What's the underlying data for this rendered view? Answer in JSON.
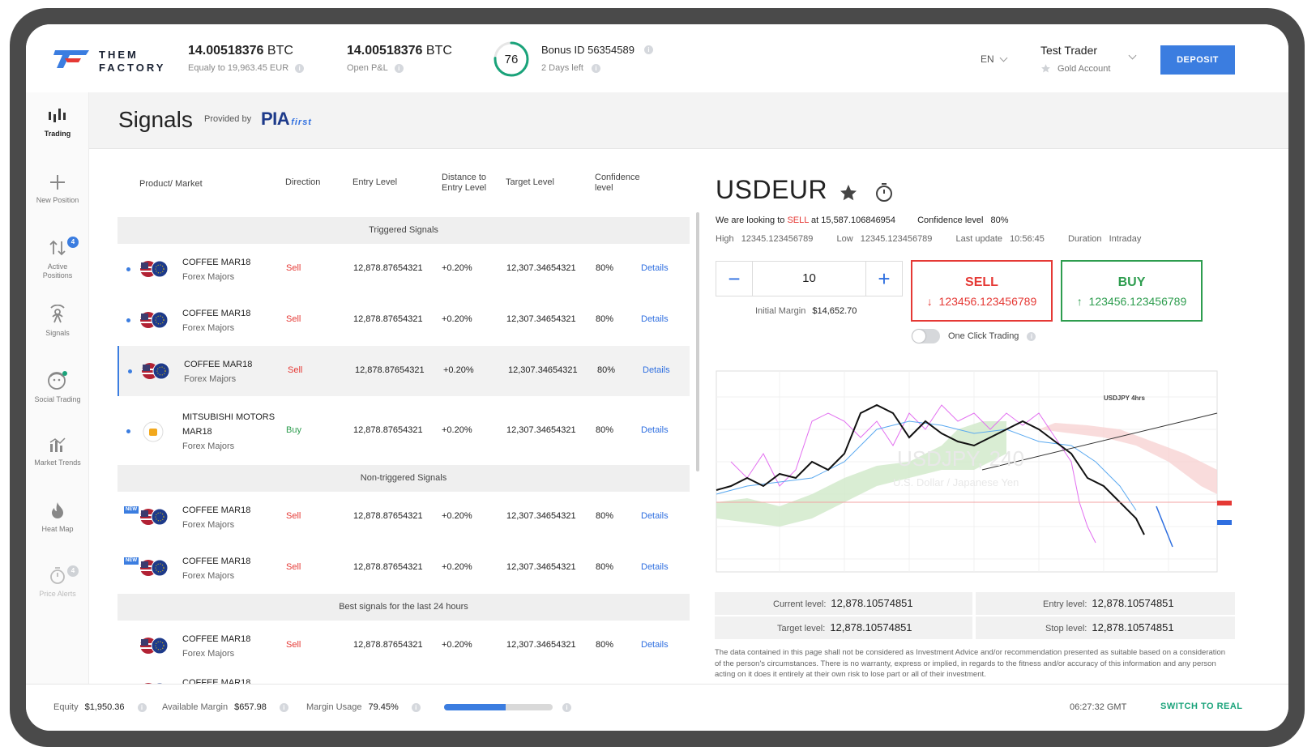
{
  "app": {
    "logo_line1": "THEM",
    "logo_line2": "FACTORY"
  },
  "header": {
    "balance_value": "14.00518376",
    "balance_unit": "BTC",
    "balance_sub": "Equaly to 19,963.45 EUR",
    "pnl_value": "14.00518376",
    "pnl_unit": "BTC",
    "pnl_sub": "Open P&L",
    "bonus_score": "76",
    "bonus_score_fraction": 0.76,
    "bonus_title": "Bonus ID 56354589",
    "bonus_sub": "2 Days left",
    "language": "EN",
    "user_name": "Test Trader",
    "account_type": "Gold Account",
    "deposit_label": "DEPOSIT"
  },
  "sidebar": {
    "items": [
      {
        "label": "Trading"
      },
      {
        "label": "New Position"
      },
      {
        "label": "Active Positions",
        "badge": "4"
      },
      {
        "label": "Signals"
      },
      {
        "label": "Social Trading"
      },
      {
        "label": "Market Trends"
      },
      {
        "label": "Heat Map"
      },
      {
        "label": "Price Alerts",
        "badge": "4"
      }
    ]
  },
  "page": {
    "title": "Signals",
    "provided_by": "Provided by",
    "provider_name": "PIA",
    "provider_suffix": "first"
  },
  "table": {
    "columns": [
      "Product/ Market",
      "Direction",
      "Entry Level",
      "Distance to",
      "Entry Level",
      "Target Level",
      "Confidence",
      "level"
    ],
    "sections": [
      "Triggered Signals",
      "Non-triggered Signals",
      "Best signals for the last 24 hours"
    ],
    "rows": [
      {
        "name": "COFFEE MAR18",
        "market": "Forex Majors",
        "direction": "Sell",
        "entry": "12,878.87654321",
        "distance": "+0.20%",
        "target": "12,307.34654321",
        "confidence": "80%",
        "details": "Details"
      },
      {
        "name": "COFFEE MAR18",
        "market": "Forex Majors",
        "direction": "Sell",
        "entry": "12,878.87654321",
        "distance": "+0.20%",
        "target": "12,307.34654321",
        "confidence": "80%",
        "details": "Details"
      },
      {
        "name": "COFFEE MAR18",
        "market": "Forex Majors",
        "direction": "Sell",
        "entry": "12,878.87654321",
        "distance": "+0.20%",
        "target": "12,307.34654321",
        "confidence": "80%",
        "details": "Details"
      },
      {
        "name": "MITSUBISHI MOTORS",
        "name2": "MAR18",
        "market": "Forex Majors",
        "direction": "Buy",
        "entry": "12,878.87654321",
        "distance": "+0.20%",
        "target": "12,307.34654321",
        "confidence": "80%",
        "details": "Details"
      },
      {
        "name": "COFFEE MAR18",
        "market": "Forex Majors",
        "direction": "Sell",
        "entry": "12,878.87654321",
        "distance": "+0.20%",
        "target": "12,307.34654321",
        "confidence": "80%",
        "details": "Details",
        "tag": "NEW"
      },
      {
        "name": "COFFEE MAR18",
        "market": "Forex Majors",
        "direction": "Sell",
        "entry": "12,878.87654321",
        "distance": "+0.20%",
        "target": "12,307.34654321",
        "confidence": "80%",
        "details": "Details",
        "tag": "NEW"
      },
      {
        "name": "COFFEE MAR18",
        "market": "Forex Majors",
        "direction": "Sell",
        "entry": "12,878.87654321",
        "distance": "+0.20%",
        "target": "12,307.34654321",
        "confidence": "80%",
        "details": "Details"
      },
      {
        "name": "COFFEE MAR18"
      }
    ]
  },
  "detail": {
    "symbol": "USDEUR",
    "looking_prefix": "We are looking to",
    "looking_action": "SELL",
    "looking_suffix": "at 15,587.106846954",
    "confidence_label": "Confidence level",
    "confidence_value": "80%",
    "high_label": "High",
    "high_value": "12345.123456789",
    "low_label": "Low",
    "low_value": "12345.123456789",
    "last_update_label": "Last update",
    "last_update_value": "10:56:45",
    "duration_label": "Duration",
    "duration_value": "Intraday",
    "quantity": "10",
    "initial_margin_label": "Initial Margin",
    "initial_margin_value": "$14,652.70",
    "sell_label": "SELL",
    "sell_price": "123456.123456789",
    "buy_label": "BUY",
    "buy_price": "123456.123456789",
    "one_click_label": "One Click Trading",
    "chart_title": "USDJPY 4hrs",
    "chart_watermark": "USDJPY, 240",
    "chart_watermark_sub": "U.S. Dollar / Japanese Yen",
    "current_level_label": "Current level:",
    "current_level_value": "12,878.10574851",
    "entry_level_label": "Entry level:",
    "entry_level_value": "12,878.10574851",
    "target_level_label": "Target level:",
    "target_level_value": "12,878.10574851",
    "stop_level_label": "Stop level:",
    "stop_level_value": "12,878.10574851",
    "disclaimer": "The data contained in this page shall not be considered as Investment Advice and/or recommendation presented as suitable based on a consideration of the person's circumstances. There is no warranty, express or implied, in regards to the fitness and/or accuracy of this information and any person acting on it does it entirely at their own risk to lose part or all of their investment."
  },
  "footer": {
    "equity_label": "Equity",
    "equity_value": "$1,950.36",
    "available_margin_label": "Available Margin",
    "available_margin_value": "$657.98",
    "margin_usage_label": "Margin Usage",
    "margin_usage_value": "79.45%",
    "margin_usage_bar_fraction": 0.57,
    "time": "06:27:32 GMT",
    "switch_label": "SWITCH TO REAL"
  },
  "colors": {
    "accent": "#3b7de0",
    "sell": "#e53935",
    "buy": "#2e9d4f",
    "switch": "#1aa37a"
  }
}
